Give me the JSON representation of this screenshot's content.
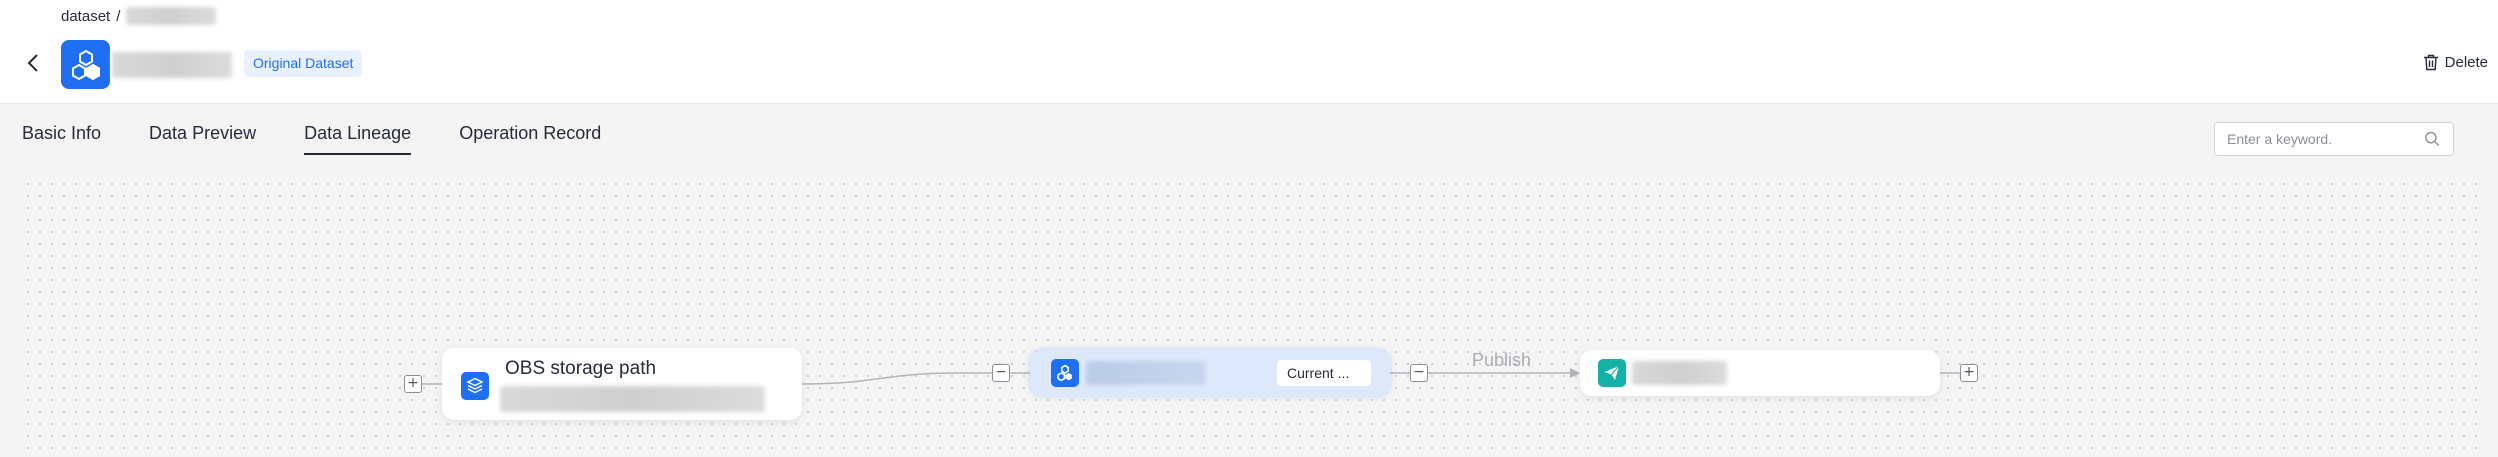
{
  "breadcrumb": {
    "root": "dataset",
    "separator": "/"
  },
  "header": {
    "tag": "Original Dataset",
    "delete_label": "Delete"
  },
  "tabs": [
    {
      "label": "Basic Info",
      "active": false
    },
    {
      "label": "Data Preview",
      "active": false
    },
    {
      "label": "Data Lineage",
      "active": true
    },
    {
      "label": "Operation Record",
      "active": false
    }
  ],
  "search": {
    "placeholder": "Enter a keyword.",
    "value": ""
  },
  "lineage": {
    "source_node": {
      "title": "OBS storage path"
    },
    "current_node": {
      "badge": "Current ..."
    },
    "edge_label": "Publish"
  },
  "colors": {
    "accent": "#1f6ff2",
    "publish_icon": "#13b1a6",
    "current_node_bg": "#dde9fb"
  },
  "icons": {
    "back": "chevron-left-icon",
    "dataset": "hexagons-icon",
    "delete": "trash-icon",
    "search": "search-icon",
    "source": "layers-icon",
    "publish": "paper-plane-icon"
  }
}
